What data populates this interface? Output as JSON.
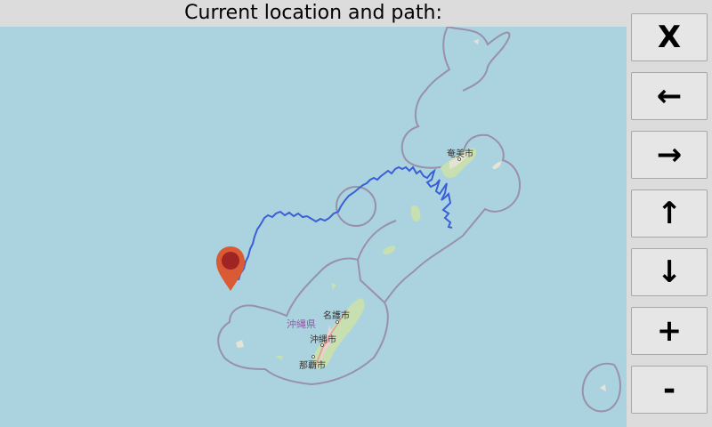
{
  "title": "Current location and path:",
  "controls": {
    "close": "X",
    "left": "←",
    "right": "→",
    "up": "↑",
    "down": "↓",
    "zoom_in": "+",
    "zoom_out": "-"
  },
  "map": {
    "labels": {
      "amami": "奄美市",
      "okinawa_pref": "沖縄県",
      "nago": "名護市",
      "okinawa_city": "沖縄市",
      "naha": "那覇市"
    },
    "colors": {
      "water": "#aad3df",
      "land": "#f2efe9",
      "forest": "#c8e0b0",
      "urban": "#eccfd4",
      "boundary": "#9990aa",
      "path": "#3b5fd4",
      "marker": "#d95a33",
      "marker_dot": "#a02424"
    }
  }
}
